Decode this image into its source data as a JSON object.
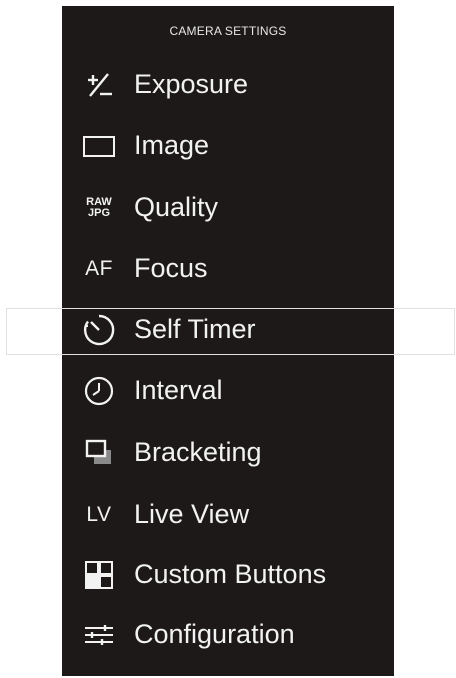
{
  "header": {
    "title": "CAMERA SETTINGS"
  },
  "menu": {
    "items": [
      {
        "label": "Exposure",
        "icon": "exposure-compensation-icon"
      },
      {
        "label": "Image",
        "icon": "image-frame-icon"
      },
      {
        "label": "Quality",
        "icon": "raw-jpg-icon",
        "icon_text_top": "RAW",
        "icon_text_bottom": "JPG"
      },
      {
        "label": "Focus",
        "icon": "autofocus-icon",
        "icon_text": "AF"
      },
      {
        "label": "Self Timer",
        "icon": "self-timer-icon",
        "selected": true
      },
      {
        "label": "Interval",
        "icon": "interval-clock-icon"
      },
      {
        "label": "Bracketing",
        "icon": "bracketing-icon"
      },
      {
        "label": "Live View",
        "icon": "live-view-icon",
        "icon_text": "LV"
      },
      {
        "label": "Custom Buttons",
        "icon": "custom-buttons-icon"
      },
      {
        "label": "Configuration",
        "icon": "configuration-sliders-icon"
      }
    ]
  },
  "colors": {
    "panel_background": "#1c1918",
    "text": "#f2f2f2",
    "selection_border": "#e0e0e0"
  }
}
